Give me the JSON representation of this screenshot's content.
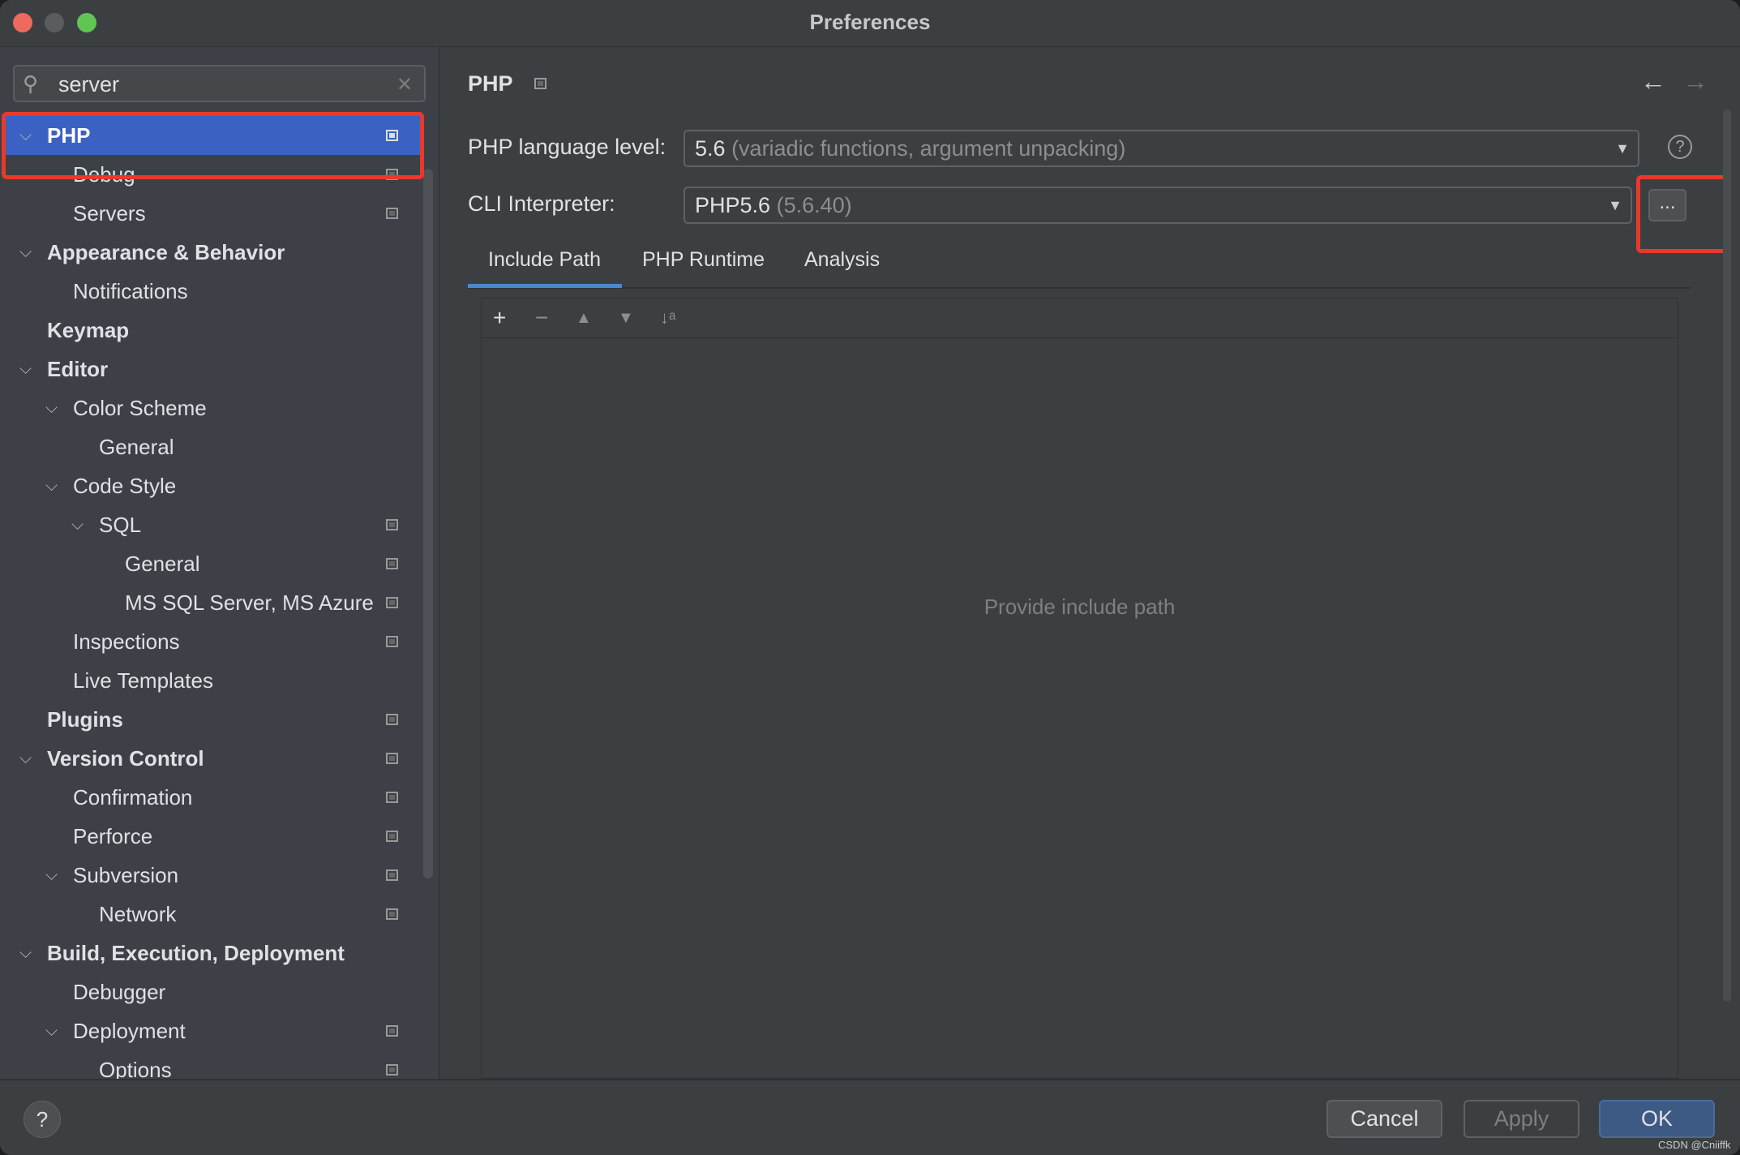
{
  "window": {
    "title": "Preferences"
  },
  "search": {
    "value": "server"
  },
  "tree": [
    {
      "label": "PHP",
      "level": 0,
      "bold": true,
      "expanded": true,
      "config": true,
      "selected": true
    },
    {
      "label": "Debug",
      "level": 1,
      "config": true
    },
    {
      "label": "Servers",
      "level": 1,
      "config": true
    },
    {
      "label": "Appearance & Behavior",
      "level": 0,
      "bold": true,
      "expanded": true
    },
    {
      "label": "Notifications",
      "level": 1
    },
    {
      "label": "Keymap",
      "level": 0,
      "bold": true
    },
    {
      "label": "Editor",
      "level": 0,
      "bold": true,
      "expanded": true
    },
    {
      "label": "Color Scheme",
      "level": 1,
      "expanded": true
    },
    {
      "label": "General",
      "level": 2
    },
    {
      "label": "Code Style",
      "level": 1,
      "expanded": true
    },
    {
      "label": "SQL",
      "level": 2,
      "expanded": true,
      "config": true
    },
    {
      "label": "General",
      "level": 3,
      "config": true
    },
    {
      "label": "MS SQL Server, MS Azure",
      "level": 3,
      "config": true
    },
    {
      "label": "Inspections",
      "level": 1,
      "config": true
    },
    {
      "label": "Live Templates",
      "level": 1
    },
    {
      "label": "Plugins",
      "level": 0,
      "bold": true,
      "config": true
    },
    {
      "label": "Version Control",
      "level": 0,
      "bold": true,
      "expanded": true,
      "config": true
    },
    {
      "label": "Confirmation",
      "level": 1,
      "config": true
    },
    {
      "label": "Perforce",
      "level": 1,
      "config": true
    },
    {
      "label": "Subversion",
      "level": 1,
      "expanded": true,
      "config": true
    },
    {
      "label": "Network",
      "level": 2,
      "config": true
    },
    {
      "label": "Build, Execution, Deployment",
      "level": 0,
      "bold": true,
      "expanded": true
    },
    {
      "label": "Debugger",
      "level": 1
    },
    {
      "label": "Deployment",
      "level": 1,
      "expanded": true,
      "config": true
    },
    {
      "label": "Options",
      "level": 2,
      "config": true
    }
  ],
  "main": {
    "header": "PHP",
    "language_level_label": "PHP language level:",
    "language_level_value": "5.6",
    "language_level_hint": "(variadic functions, argument unpacking)",
    "cli_label": "CLI Interpreter:",
    "cli_value": "PHP5.6",
    "cli_hint": "(5.6.40)",
    "more_button": "...",
    "tabs": [
      "Include Path",
      "PHP Runtime",
      "Analysis"
    ],
    "active_tab": "Include Path",
    "empty_text": "Provide include path"
  },
  "footer": {
    "help": "?",
    "cancel": "Cancel",
    "apply": "Apply",
    "ok": "OK",
    "watermark": "CSDN @Cniiffk"
  },
  "colors": {
    "accent": "#3b62c2",
    "highlight": "#e8392a",
    "ok": "#3d5a84"
  }
}
